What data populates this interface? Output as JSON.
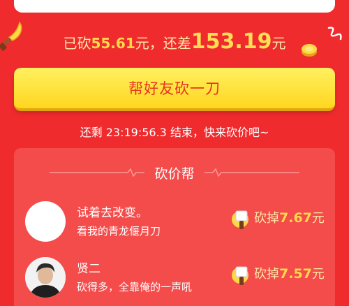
{
  "progress": {
    "prefix": "已砍",
    "cut_amount": "55.61",
    "middle": "元，还差",
    "remaining_amount": "153.19",
    "suffix": "元"
  },
  "help_button": {
    "label": "帮好友砍一刀"
  },
  "countdown": {
    "text": "还剩 23:19:56.3 结束，快来砍价吧~"
  },
  "helpers_panel": {
    "title": "砍价帮",
    "helpers": [
      {
        "name": "试着去改变。",
        "message": "看我的青龙偃月刀",
        "cut_label": "砍掉",
        "cut_value": "7.67",
        "unit": "元"
      },
      {
        "name": "贤二",
        "message": "砍得多，全靠俺的一声吼",
        "cut_label": "砍掉",
        "cut_value": "7.57",
        "unit": "元"
      }
    ]
  },
  "colors": {
    "background": "#ef2b2d",
    "button": "#ffd61f",
    "accent_text": "#ffd94a"
  }
}
